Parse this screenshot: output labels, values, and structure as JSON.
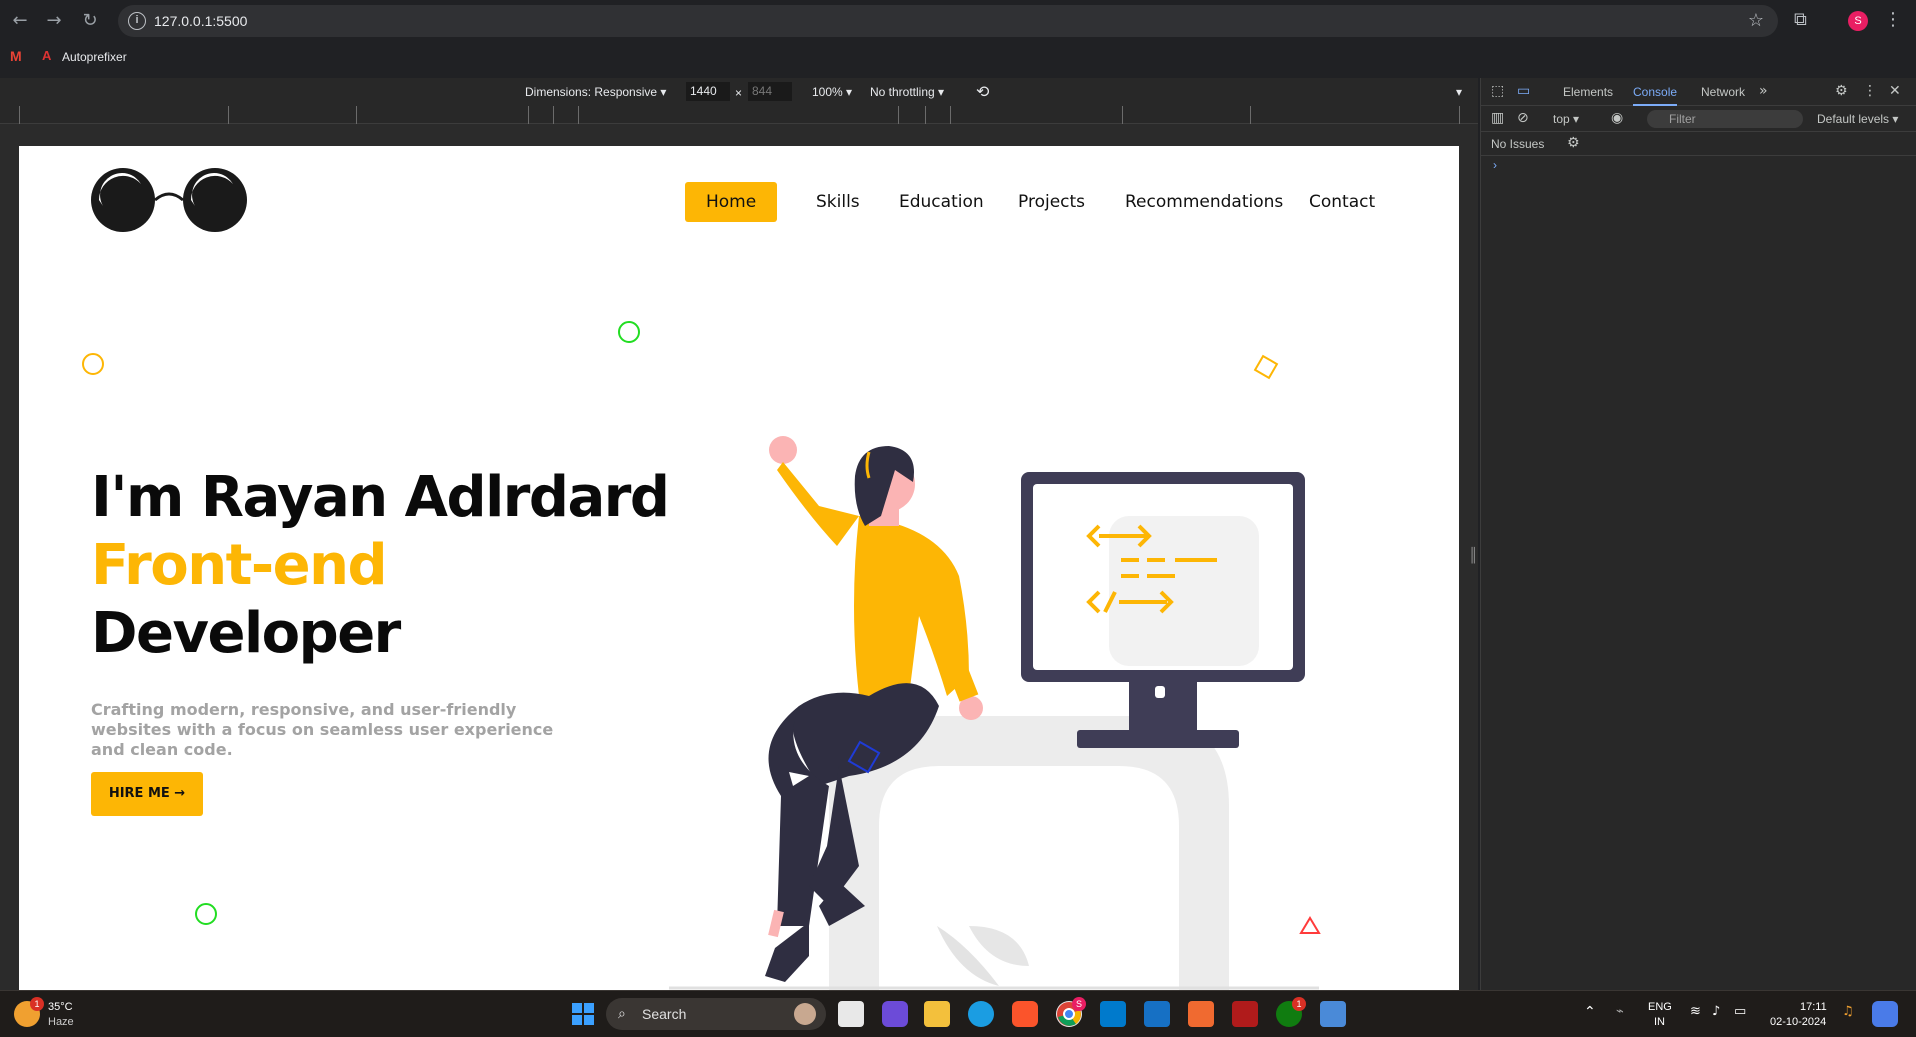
{
  "browser": {
    "url": "127.0.0.1:5500",
    "profile_initial": "S",
    "bookmarks": [
      {
        "label": "Autoprefixer"
      }
    ]
  },
  "device_toolbar": {
    "dimensions_label": "Dimensions: Responsive",
    "width": "1440",
    "height_placeholder": "844",
    "x_sep": "×",
    "zoom": "100%",
    "throttling": "No throttling"
  },
  "site": {
    "nav": [
      "Home",
      "Skills",
      "Education",
      "Projects",
      "Recommendations",
      "Contact"
    ],
    "active_nav": "Home",
    "hero": {
      "line1": "I'm Rayan Adlrdard",
      "line2": "Front-end",
      "line3": "Developer",
      "description": "Crafting modern, responsive, and user-friendly websites with a focus on seamless user experience and clean code.",
      "cta": "HIRE ME →"
    },
    "colors": {
      "accent": "#fdb605",
      "text": "#0a0a0a",
      "muted": "#a3a3a3",
      "green_shape": "#22dd22",
      "red_shape": "#ff3b3b",
      "blue_shape": "#1f3bd6"
    }
  },
  "devtools": {
    "tabs": [
      "Elements",
      "Console",
      "Network"
    ],
    "active_tab": "Console",
    "context": "top",
    "filter_placeholder": "Filter",
    "levels": "Default levels",
    "issues": "No Issues",
    "prompt": "›"
  },
  "taskbar": {
    "weather_temp": "35°C",
    "weather_desc": "Haze",
    "weather_badge": "1",
    "search_label": "Search",
    "lang": "ENG",
    "region": "IN",
    "time": "17:11",
    "date": "02-10-2024",
    "chrome_badge": "S",
    "xbox_badge": "1"
  }
}
